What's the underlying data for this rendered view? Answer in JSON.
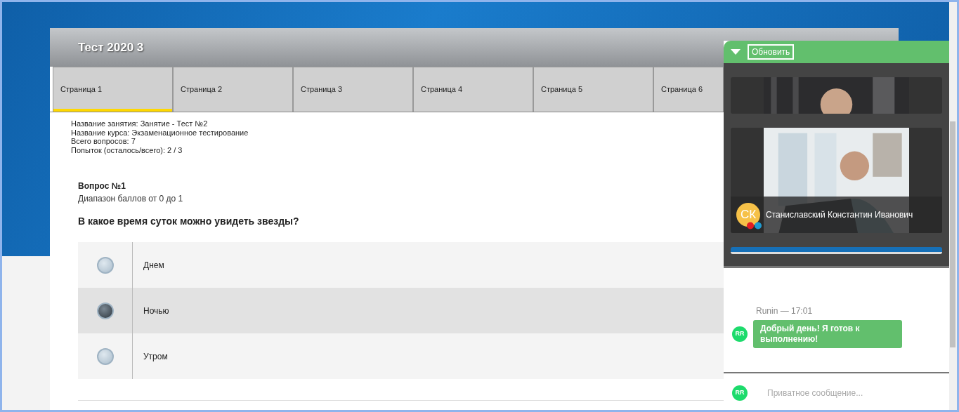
{
  "test": {
    "title": "Тест 2020 3"
  },
  "tabs": [
    {
      "label": "Страница 1",
      "selected": true
    },
    {
      "label": "Страница 2",
      "selected": false
    },
    {
      "label": "Страница 3",
      "selected": false
    },
    {
      "label": "Страница 4",
      "selected": false
    },
    {
      "label": "Страница 5",
      "selected": false
    },
    {
      "label": "Страница 6",
      "selected": false
    }
  ],
  "info": [
    "Название занятия: Занятие - Тест №2",
    "Название курса: Экзаменационное тестирование",
    "Всего вопросов: 7",
    "Попыток (осталось/всего): 2 / 3"
  ],
  "question": {
    "number": "Вопрос №1",
    "range": "Диапазон баллов от 0 до 1",
    "text": "В какое время суток можно увидеть звезды?",
    "options": [
      {
        "label": "Днем",
        "selected": false
      },
      {
        "label": "Ночью",
        "selected": true
      },
      {
        "label": "Утром",
        "selected": false
      }
    ]
  },
  "chat": {
    "refresh_button": "Обновить",
    "videos": [
      {
        "kind": "picture"
      },
      {
        "kind": "picture",
        "initials": "СК",
        "name": "Станиславский Константин Иванович"
      },
      {
        "kind": "screen"
      }
    ],
    "messages": [
      {
        "author": "Runin",
        "separator": "—",
        "time": "17:01",
        "avatar": "RR",
        "text": "Добрый день! Я готов к выполнению!"
      }
    ],
    "input": {
      "avatar": "RR",
      "placeholder": "Приватное сообщение..."
    }
  }
}
